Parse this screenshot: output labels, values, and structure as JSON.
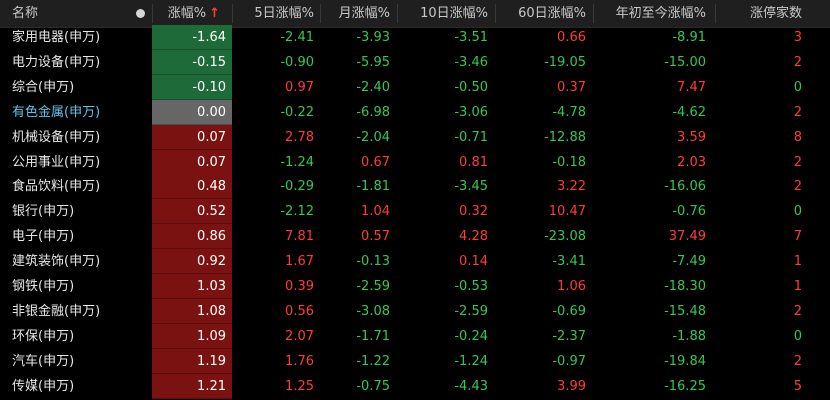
{
  "header": {
    "name": "名称",
    "chg": "涨幅%",
    "sort_arrow": "↑",
    "d5": "5日涨幅%",
    "month": "月涨幅%",
    "d10": "10日涨幅%",
    "d60": "60日涨幅%",
    "ytd": "年初至今涨幅%",
    "limit": "涨停家数"
  },
  "colors": {
    "up": "#ff3b3b",
    "down": "#34c759",
    "neg_bg": "#1f6a39",
    "pos_bg": "#7a1212",
    "zero_bg": "#666666"
  },
  "rows": [
    {
      "name": "家用电器(申万)",
      "chg": "-1.64",
      "d5": "-2.41",
      "month": "-3.93",
      "d10": "-3.51",
      "d60": "0.66",
      "ytd": "-8.91",
      "limit": "3"
    },
    {
      "name": "电力设备(申万)",
      "chg": "-0.15",
      "d5": "-0.90",
      "month": "-5.95",
      "d10": "-3.46",
      "d60": "-19.05",
      "ytd": "-15.00",
      "limit": "2"
    },
    {
      "name": "综合(申万)",
      "chg": "-0.10",
      "d5": "0.97",
      "month": "-2.40",
      "d10": "-0.50",
      "d60": "0.37",
      "ytd": "7.47",
      "limit": "0"
    },
    {
      "name": "有色金属(申万)",
      "chg": "0.00",
      "d5": "-0.22",
      "month": "-6.98",
      "d10": "-3.06",
      "d60": "-4.78",
      "ytd": "-4.62",
      "limit": "2",
      "highlight": true
    },
    {
      "name": "机械设备(申万)",
      "chg": "0.07",
      "d5": "2.78",
      "month": "-2.04",
      "d10": "-0.71",
      "d60": "-12.88",
      "ytd": "3.59",
      "limit": "8"
    },
    {
      "name": "公用事业(申万)",
      "chg": "0.07",
      "d5": "-1.24",
      "month": "0.67",
      "d10": "0.81",
      "d60": "-0.18",
      "ytd": "2.03",
      "limit": "2"
    },
    {
      "name": "食品饮料(申万)",
      "chg": "0.48",
      "d5": "-0.29",
      "month": "-1.81",
      "d10": "-3.45",
      "d60": "3.22",
      "ytd": "-16.06",
      "limit": "2"
    },
    {
      "name": "银行(申万)",
      "chg": "0.52",
      "d5": "-2.12",
      "month": "1.04",
      "d10": "0.32",
      "d60": "10.47",
      "ytd": "-0.76",
      "limit": "0"
    },
    {
      "name": "电子(申万)",
      "chg": "0.86",
      "d5": "7.81",
      "month": "0.57",
      "d10": "4.28",
      "d60": "-23.08",
      "ytd": "37.49",
      "limit": "7"
    },
    {
      "name": "建筑装饰(申万)",
      "chg": "0.92",
      "d5": "1.67",
      "month": "-0.13",
      "d10": "0.14",
      "d60": "-3.41",
      "ytd": "-7.49",
      "limit": "1"
    },
    {
      "name": "钢铁(申万)",
      "chg": "1.03",
      "d5": "0.39",
      "month": "-2.59",
      "d10": "-0.53",
      "d60": "1.06",
      "ytd": "-18.30",
      "limit": "1"
    },
    {
      "name": "非银金融(申万)",
      "chg": "1.08",
      "d5": "0.56",
      "month": "-3.08",
      "d10": "-2.59",
      "d60": "-0.69",
      "ytd": "-15.48",
      "limit": "2"
    },
    {
      "name": "环保(申万)",
      "chg": "1.09",
      "d5": "2.07",
      "month": "-1.71",
      "d10": "-0.24",
      "d60": "-2.37",
      "ytd": "-1.88",
      "limit": "0"
    },
    {
      "name": "汽车(申万)",
      "chg": "1.19",
      "d5": "1.76",
      "month": "-1.22",
      "d10": "-1.24",
      "d60": "-0.97",
      "ytd": "-19.84",
      "limit": "2"
    },
    {
      "name": "传媒(申万)",
      "chg": "1.21",
      "d5": "1.25",
      "month": "-0.75",
      "d10": "-4.43",
      "d60": "3.99",
      "ytd": "-16.25",
      "limit": "5"
    }
  ]
}
